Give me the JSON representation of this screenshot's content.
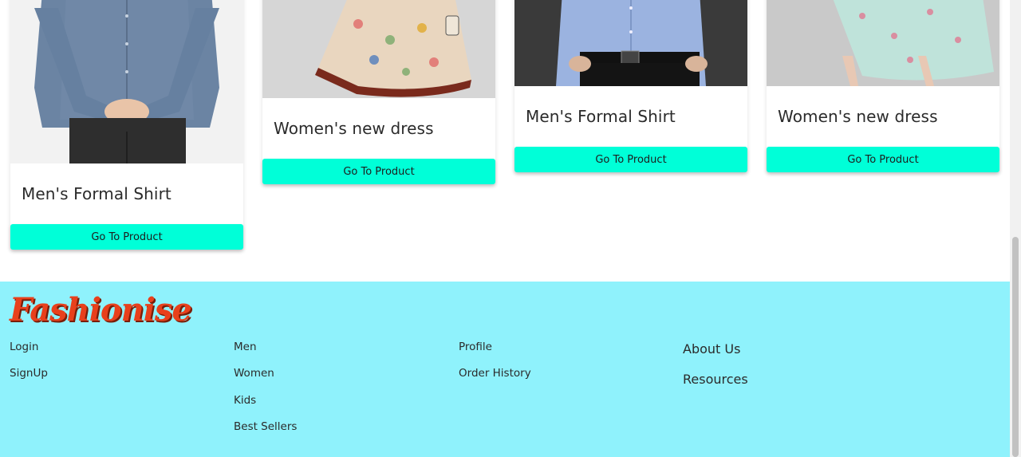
{
  "products": [
    {
      "title": "Men's Formal Shirt",
      "button": "Go To Product"
    },
    {
      "title": "Women's new dress",
      "button": "Go To Product"
    },
    {
      "title": "Men's Formal Shirt",
      "button": "Go To Product"
    },
    {
      "title": "Women's new dress",
      "button": "Go To Product"
    }
  ],
  "footer": {
    "logo": "Fashionise",
    "account_links": [
      "Login",
      "SignUp"
    ],
    "category_links": [
      "Men",
      "Women",
      "Kids",
      "Best Sellers"
    ],
    "user_links": [
      "Profile",
      "Order History"
    ],
    "info_links": [
      "About Us",
      "Resources"
    ]
  },
  "colors": {
    "accent_button": "#00ffd8",
    "footer_bg": "#8ff2fc",
    "logo": "#e8401c"
  }
}
